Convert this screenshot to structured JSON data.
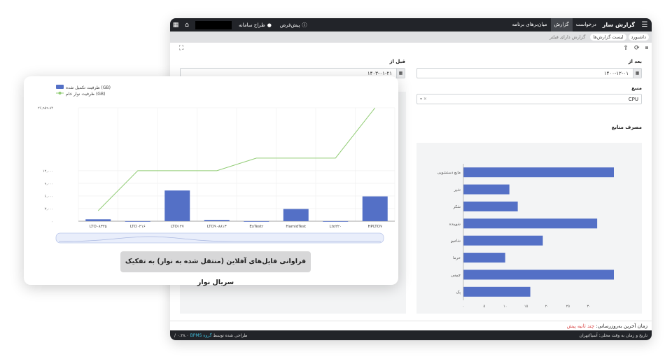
{
  "app": {
    "brand": "گزارش ساز",
    "menu": [
      "درخواست",
      "گزارش",
      "میان‌برهای برنامه"
    ],
    "active_menu": 1,
    "default_label": "پیش‌فرض",
    "user_label": "طراح سامانه",
    "breadcrumb": [
      "داشبورد",
      "لیست گزارش‌ها",
      "گزارش دارای فیلتر"
    ],
    "filters": {
      "after_label": "بعد از",
      "after_value": "۱۴۰۰-۱۲-۰۱",
      "before_label": "قبل از",
      "before_value": "۱۴۰۳-۰۱-۲۱",
      "source_label": "منبع",
      "source_value": "CPU"
    },
    "section_title": "مصرف منابع",
    "footer": {
      "refresh_label": "زمان آخرین به‌روزرسانی:",
      "refresh_value": "چند ثانیه پیش",
      "locale_text": "تاریخ و زمان به وقت محلی: آسیا/تهران",
      "designed_by": "طراحی شده توسط",
      "company": "گروه BPMS",
      "version": "۰.۲۸.۰ /"
    },
    "colors": {
      "topbar": "#222429",
      "bar": "#5470c6",
      "line": "#91cc75"
    }
  },
  "chart_data": [
    {
      "type": "bar",
      "orientation": "horizontal",
      "categories": [
        "پک",
        "چیپس",
        "خرما",
        "شامپو",
        "شوینده",
        "شکر",
        "شیر",
        "مایع دستشویی"
      ],
      "values": [
        16,
        36,
        10,
        19,
        32,
        13,
        11,
        36
      ],
      "xlim": [
        0,
        36
      ],
      "x_ticks": [
        "۰",
        "۵",
        "۱۰",
        "۱۵",
        "۲۰",
        "۲۵",
        "۳۰"
      ],
      "grid": false
    },
    {
      "type": "bar+line",
      "title": "فراوانی فایل‌های آفلاین (منتقل شده به نوار) به تفکیک سریال نوار",
      "categories": [
        "LTO۰۸۳۲۵",
        "LTO۰۲۱۶",
        "LTO۱۲۷",
        "LTO۹۰۸۸۱۳",
        "ExTestr",
        "HamidTest",
        "Lto۲۲۰",
        "HPLTO۷"
      ],
      "series": [
        {
          "name": "ظرفیت تکمیل شده (GB)",
          "kind": "bar",
          "values": [
            450,
            0,
            7300,
            300,
            0,
            2900,
            0,
            5900
          ]
        },
        {
          "name": "ظرفیت نوار خام (GB)",
          "kind": "line",
          "values": [
            2500,
            12000,
            12000,
            12000,
            15000,
            15000,
            15000,
            26959
          ]
        }
      ],
      "ylim": [
        0,
        26959.84
      ],
      "y_ticks": [
        "۰",
        "۳,۰۰۰",
        "۶,۰۰۰",
        "۹,۰۰۰",
        "۱۲,۰۰۰",
        "۲۶,۹۵۹.۸۴"
      ],
      "legend": "top-left",
      "grid": true
    }
  ]
}
